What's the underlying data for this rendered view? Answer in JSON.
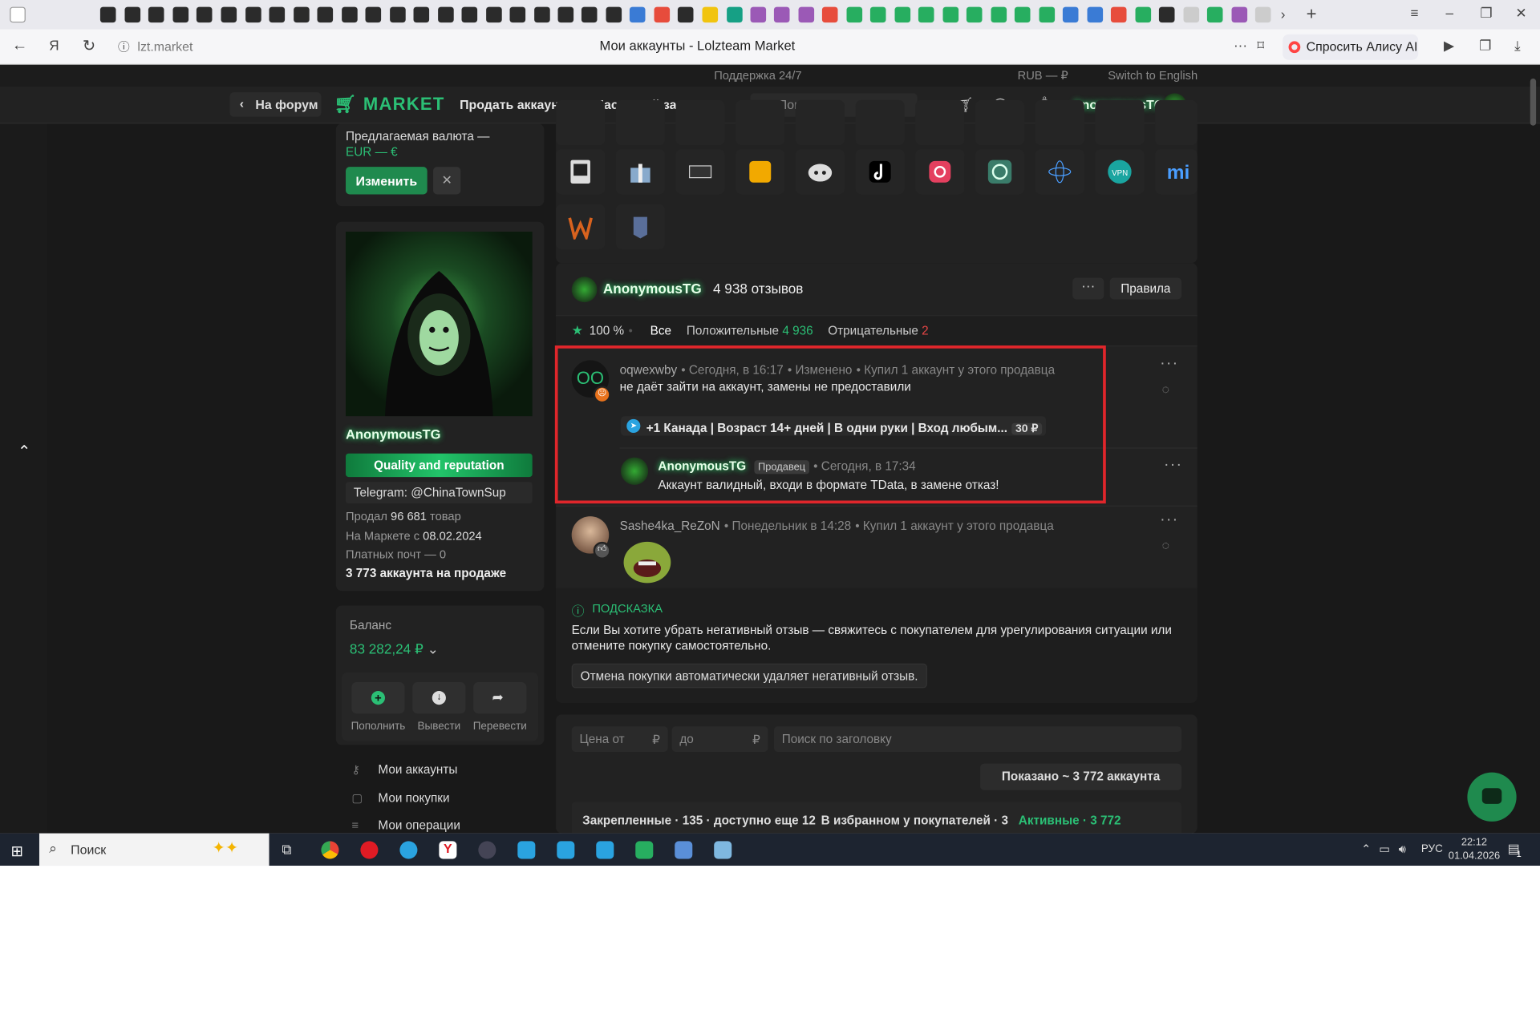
{
  "browser": {
    "url": "lzt.market",
    "title": "Мои аккаунты - Lolzteam Market",
    "alice": "Спросить Алису AI"
  },
  "topbar": {
    "support": "Поддержка 24/7",
    "currency": "RUB — ₽",
    "language": "Switch to English"
  },
  "nav": {
    "back": "На форум",
    "logo": "MARKET",
    "sell": "Продать аккаунт",
    "mass": "Массовый залив",
    "search_placeholder": "Поиск...",
    "user": "AnonymousTG"
  },
  "sidebar": {
    "currency_label": "Предлагаемая валюта —",
    "currency_value": "EUR — €",
    "change": "Изменить",
    "username": "AnonymousTG",
    "badge": "Quality and reputation",
    "telegram": "Telegram: @ChinaTownSup",
    "sold_prefix": "Продал ",
    "sold_value": "96 681",
    "sold_suffix": " товар",
    "since_prefix": "На Маркете с ",
    "since_value": "08.02.2024",
    "paid_mails": "Платных почт — 0",
    "on_sale": "3 773 аккаунта на продаже",
    "balance_label": "Баланс",
    "balance_value": "83 282,24 ₽",
    "actions": [
      "Пополнить",
      "Вывести",
      "Перевести"
    ],
    "menu": [
      "Мои аккаунты",
      "Мои покупки",
      "Мои операции"
    ]
  },
  "reviews": {
    "seller": "AnonymousTG",
    "count": "4 938 отзывов",
    "rules": "Правила",
    "rating": "100 %",
    "filter_all": "Все",
    "filter_pos": "Положительные",
    "pos_count": "4 936",
    "filter_neg": "Отрицательные",
    "neg_count": "2",
    "items": [
      {
        "author": "oqwexwby",
        "time": "Сегодня, в 16:17",
        "edited": "Изменено",
        "bought": "Купил 1 аккаунт у этого продавца",
        "text": "не даёт зайти на аккаунт, замены не предоставили",
        "product": "+1 Канада | Возраст 14+ дней | В одни руки | Вход любым...",
        "price": "30 ₽",
        "reply": {
          "author": "AnonymousTG",
          "role": "Продавец",
          "time": "Сегодня, в 17:34",
          "text": "Аккаунт валидный, входи в формате TData, в замене отказ!"
        }
      },
      {
        "author": "Sashe4ka_ReZoN",
        "time": "Понедельник в 14:28",
        "bought": "Купил 1 аккаунт у этого продавца"
      }
    ],
    "hint_title": "ПОДСКАЗКА",
    "hint_text": "Если Вы хотите убрать негативный отзыв — свяжитесь с покупателем для урегулирования ситуации или отмените покупку самостоятельно.",
    "hint_note": "Отмена покупки автоматически удаляет негативный отзыв."
  },
  "filters": {
    "price_from": "Цена от",
    "price_to": "до",
    "currency": "₽",
    "title_search": "Поиск по заголовку",
    "shown": "Показано ~ 3 772 аккаунта",
    "pinned": "Закрепленные · 135 · доступно еще 12",
    "favorites": "В избранном у покупателей · 3",
    "active": "Активные · 3 772"
  },
  "taskbar": {
    "search": "Поиск",
    "lang": "РУС",
    "time": "22:12",
    "date": "01.04.2026",
    "notif": "1"
  },
  "colors": {
    "accent": "#2bbf75",
    "highlight_box": "#e0262b",
    "negative": "#e54545"
  }
}
